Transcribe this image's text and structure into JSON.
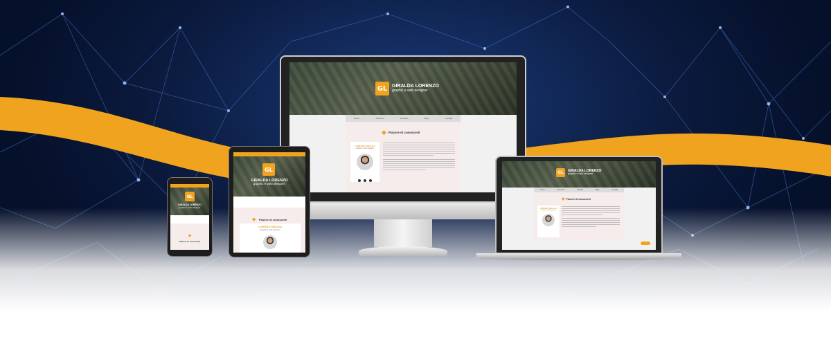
{
  "site": {
    "brand_name": "GIRALDA LORENZO",
    "brand_tagline": "graphic e web designer",
    "logo_letters": "GL",
    "nav_items": [
      "Home",
      "Chi sono",
      "Portfolio",
      "Blog",
      "Contatti"
    ],
    "section_title": "Piacere di conoscerti",
    "profile_name": "LORENZO GIRALDA",
    "profile_role": "Graphic e web designer"
  },
  "colors": {
    "accent": "#f0a31e",
    "hero_bg": "#0b1a3d"
  }
}
